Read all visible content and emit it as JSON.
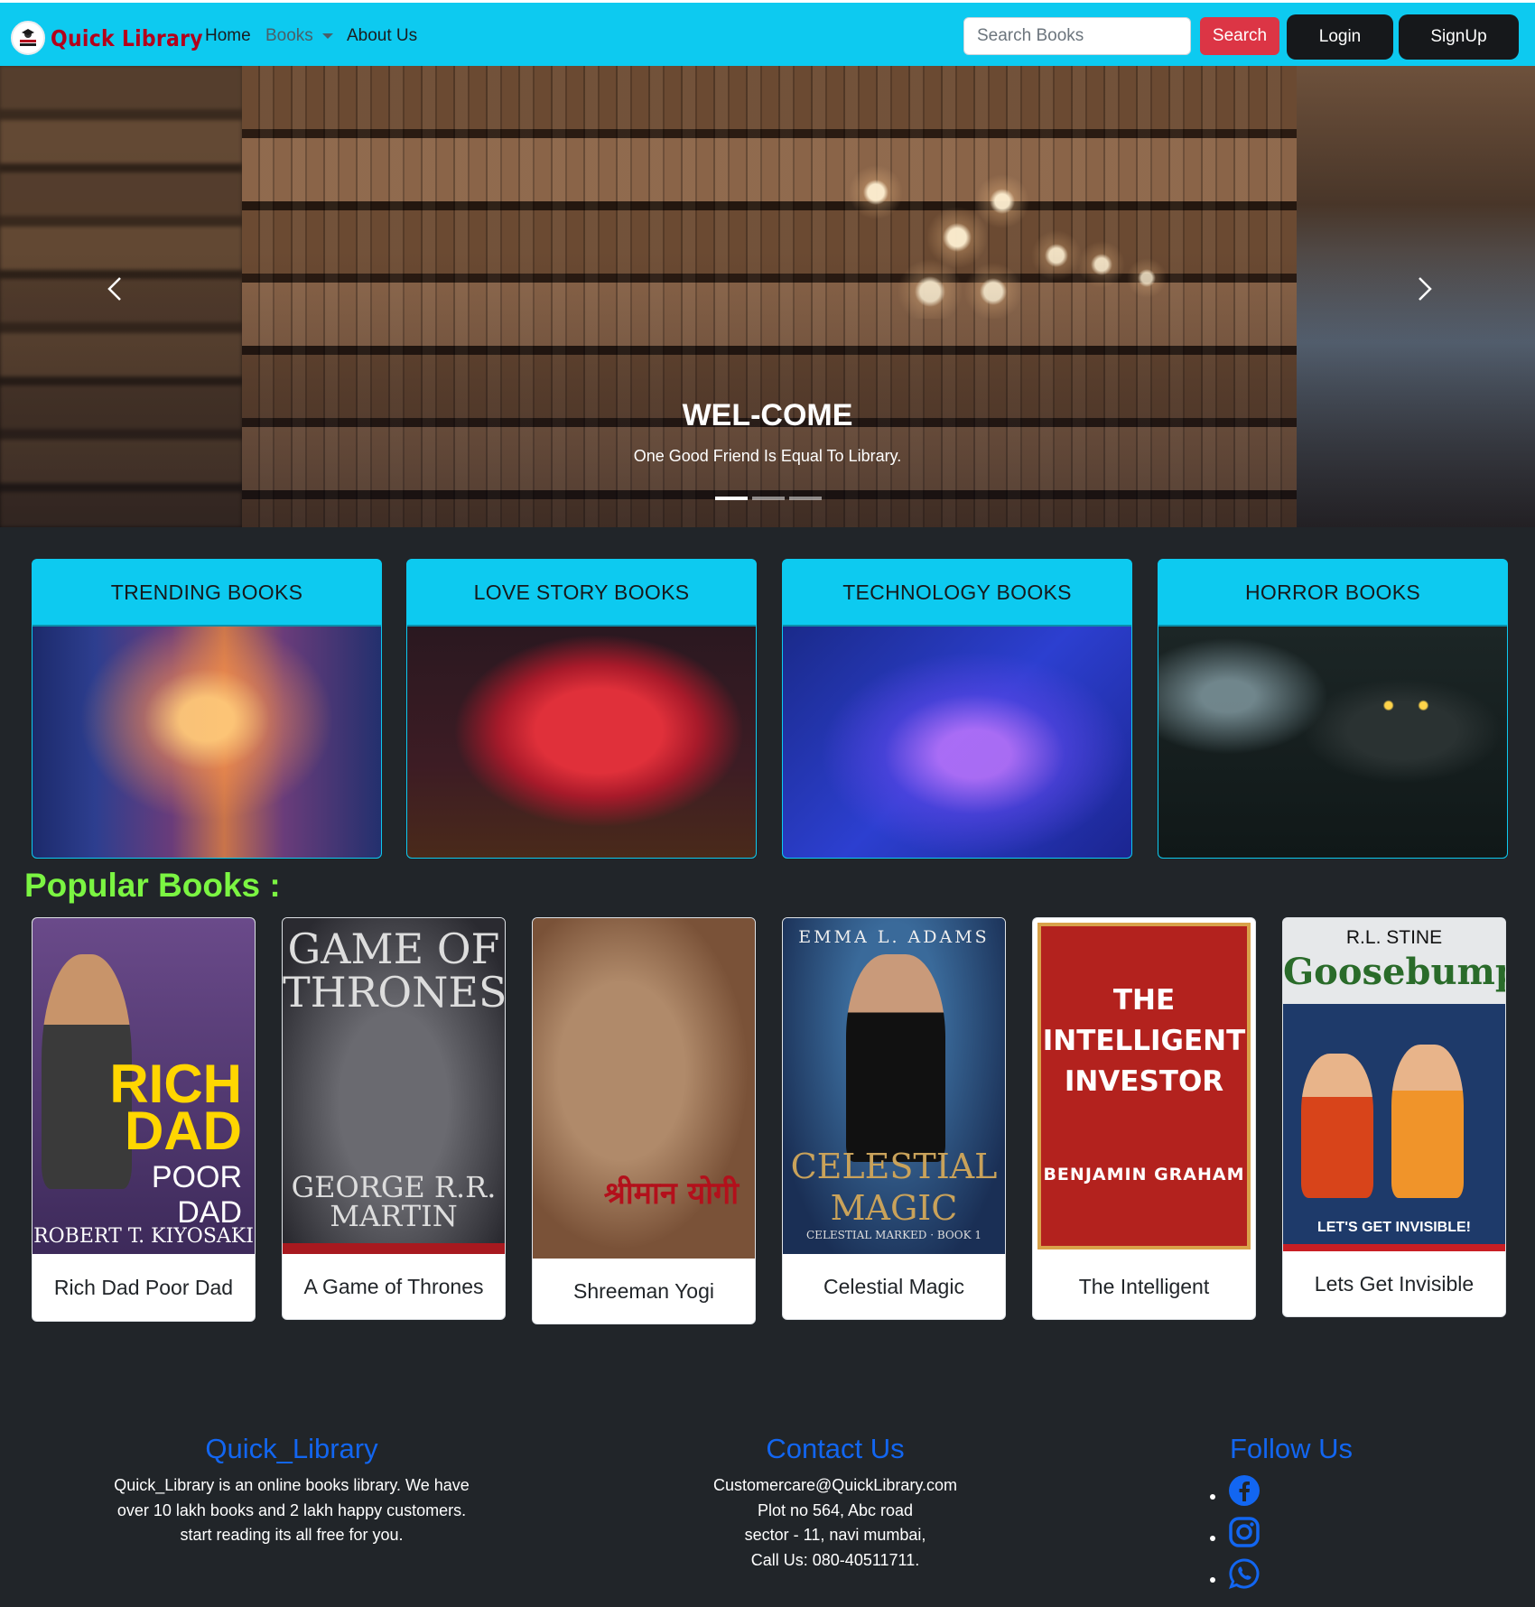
{
  "navbar": {
    "brand": "Quick Library",
    "links": {
      "home": "Home",
      "books": "Books",
      "about": "About Us"
    },
    "search_placeholder": "Search Books",
    "search_button": "Search",
    "login_button": "Login",
    "signup_button": "SignUp"
  },
  "carousel": {
    "title": "WEL-COME",
    "text": "One Good Friend Is Equal To Library.",
    "active_slide": 1,
    "slide_count": 3
  },
  "categories": [
    {
      "label": "TRENDING BOOKS"
    },
    {
      "label": "LOVE STORY BOOKS"
    },
    {
      "label": "TECHNOLOGY BOOKS"
    },
    {
      "label": "HORROR BOOKS"
    }
  ],
  "popular": {
    "heading": "Popular Books :",
    "books": [
      {
        "title": "Rich Dad Poor Dad",
        "cover_lines": [
          "RICH",
          "DAD",
          "POOR DAD",
          "ROBERT T. KIYOSAKI"
        ]
      },
      {
        "title": "A Game of Thrones",
        "cover_lines": [
          "GAME OF",
          "THRONES",
          "GEORGE R.R.",
          "MARTIN"
        ]
      },
      {
        "title": "Shreeman Yogi",
        "cover_lines": [
          "श्रीमान योगी"
        ]
      },
      {
        "title": "Celestial Magic",
        "cover_lines": [
          "EMMA L. ADAMS",
          "CELESTIAL",
          "MAGIC",
          "CELESTIAL MARKED · BOOK 1"
        ]
      },
      {
        "title": "The Intelligent",
        "cover_lines": [
          "THE",
          "INTELLIGENT",
          "INVESTOR",
          "BENJAMIN GRAHAM"
        ]
      },
      {
        "title": "Lets Get Invisible",
        "cover_lines": [
          "R.L. STINE",
          "Goosebumps",
          "LET'S GET INVISIBLE!"
        ]
      }
    ]
  },
  "footer": {
    "about": {
      "title": "Quick_Library",
      "lines": [
        "Quick_Library is an online books library. We have",
        "over 10 lakh books and 2 lakh happy customers.",
        "start reading its all free for you."
      ]
    },
    "contact": {
      "title": "Contact Us",
      "lines": [
        "Customercare@QuickLibrary.com",
        "Plot no 564, Abc road",
        "sector - 11, navi mumbai,",
        "Call Us: 080-40511711."
      ]
    },
    "follow": {
      "title": "Follow Us",
      "icons": [
        "facebook-icon",
        "instagram-icon",
        "whatsapp-icon"
      ]
    }
  },
  "colors": {
    "navbar": "#0dcaf0",
    "page_background": "#212529",
    "search_button": "#dc3545",
    "popular_heading": "#7bf542",
    "footer_heading": "#1266f1"
  }
}
